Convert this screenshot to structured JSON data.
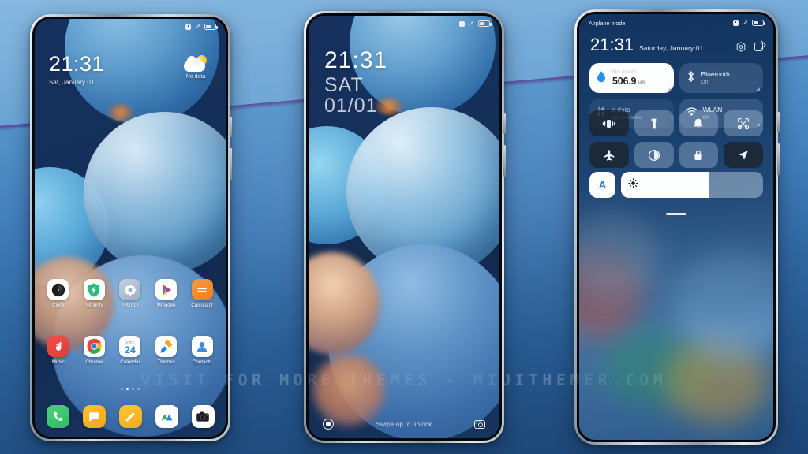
{
  "scene": {
    "watermark": "VISIT FOR MORE THEMES - MIUITHEMER.COM",
    "background_top_color": "#86b8e0",
    "background_bottom_color": "#1d4677"
  },
  "phone_home": {
    "name": "home-screen",
    "statusbar": {
      "alarm_icon": "alarm-icon",
      "airplane_icon": "airplane-icon",
      "battery_icon": "battery-icon"
    },
    "clock": {
      "time": "21:31",
      "date": "Sat, January 01"
    },
    "weather": {
      "icon": "partly-cloudy-icon",
      "label": "No data"
    },
    "apps_row1": [
      {
        "label": "Clock",
        "icon": "clock-icon"
      },
      {
        "label": "Security",
        "icon": "shield-icon"
      },
      {
        "label": "MIUI 13",
        "icon": "miui-flower-icon"
      },
      {
        "label": "Mi Video",
        "icon": "play-icon"
      },
      {
        "label": "Calculator",
        "icon": "calculator-icon"
      }
    ],
    "apps_row2": [
      {
        "label": "Music",
        "icon": "music-note-icon"
      },
      {
        "label": "Chrome",
        "icon": "chrome-icon"
      },
      {
        "label": "Calendar",
        "icon": "calendar-icon",
        "day": "24"
      },
      {
        "label": "Themes",
        "icon": "paint-roller-icon"
      },
      {
        "label": "Contacts",
        "icon": "person-icon"
      }
    ],
    "page_dots": {
      "count": 4,
      "active_index": 1
    },
    "dock": [
      {
        "label": "Phone",
        "icon": "phone-icon"
      },
      {
        "label": "Messages",
        "icon": "message-icon"
      },
      {
        "label": "Notes",
        "icon": "pencil-icon"
      },
      {
        "label": "Gallery",
        "icon": "gallery-icon"
      },
      {
        "label": "Camera",
        "icon": "camera-icon"
      }
    ]
  },
  "phone_lock": {
    "name": "lock-screen",
    "statusbar": {
      "alarm_icon": "alarm-icon",
      "airplane_icon": "airplane-icon",
      "battery_icon": "battery-icon"
    },
    "clock": {
      "time": "21:31",
      "weekday": "SAT",
      "date": "01/01"
    },
    "bottom": {
      "left_icon": "assistant-ring-icon",
      "hint": "Swipe up to unlock",
      "right_icon": "camera-icon"
    }
  },
  "phone_control": {
    "name": "control-center",
    "statusbar": {
      "label": "Airplane mode",
      "alarm_icon": "alarm-icon",
      "airplane_icon": "airplane-icon",
      "battery_icon": "battery-icon"
    },
    "header": {
      "time": "21:31",
      "date": "Saturday, January 01",
      "settings_icon": "gear-hex-icon",
      "edit_icon": "edit-icon"
    },
    "cards": [
      {
        "name": "data-usage-card",
        "icon": "data-drop-icon",
        "title": "this month",
        "value": "506.9",
        "unit": "MB",
        "state": "active"
      },
      {
        "name": "bluetooth-card",
        "icon": "bluetooth-icon",
        "title": "Bluetooth",
        "subtitle": "Off",
        "state": "off"
      },
      {
        "name": "mobile-data-card",
        "icon": "data-arrows-icon",
        "title": "e data",
        "subtitle": "Not available",
        "state": "disabled"
      },
      {
        "name": "wlan-card",
        "icon": "wifi-icon",
        "title": "WLAN",
        "subtitle": "Off",
        "state": "off"
      }
    ],
    "toggles": [
      {
        "name": "vibrate-toggle",
        "icon": "vibrate-icon",
        "state": "off"
      },
      {
        "name": "flashlight-toggle",
        "icon": "flashlight-icon",
        "state": "on"
      },
      {
        "name": "ringer-toggle",
        "icon": "bell-icon",
        "state": "on"
      },
      {
        "name": "screenshot-toggle",
        "icon": "scissors-screenshot-icon",
        "state": "on"
      },
      {
        "name": "airplane-toggle",
        "icon": "airplane-icon",
        "state": "off"
      },
      {
        "name": "dark-mode-toggle",
        "icon": "contrast-icon",
        "state": "on"
      },
      {
        "name": "screen-lock-toggle",
        "icon": "lock-icon",
        "state": "on"
      },
      {
        "name": "location-toggle",
        "icon": "location-arrow-icon",
        "state": "off"
      }
    ],
    "brightness": {
      "auto_label": "A",
      "icon": "sun-icon",
      "level_percent": 62
    },
    "grabber": "drag-handle"
  }
}
